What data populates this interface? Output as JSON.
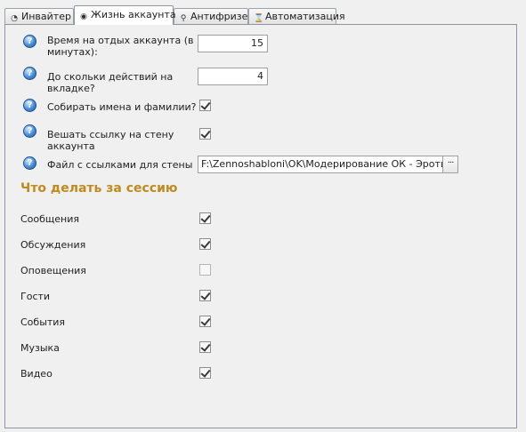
{
  "tabs": [
    {
      "label": "Инвайтер",
      "icon": "invite-icon",
      "active": false
    },
    {
      "label": "Жизнь аккаунта",
      "icon": "globe-icon",
      "active": true
    },
    {
      "label": "Антифризер",
      "icon": "search-icon",
      "active": false
    },
    {
      "label": "Автоматизация",
      "icon": "hourglass-icon",
      "active": false
    }
  ],
  "settings": {
    "rest_time_label": "Время на отдых аккаунта (в минутах):",
    "rest_time_value": "15",
    "actions_label": "До скольки действий на вкладке?",
    "actions_value": "4",
    "collect_names_label": "Собирать имена и фамилии?",
    "collect_names_checked": true,
    "wall_link_label": "Вешать ссылку на стену аккаунта",
    "wall_link_checked": true,
    "links_file_label": "Файл с ссылками для стены",
    "links_file_value": "F:\\Zennoshabloni\\OK\\Модерирование ОК - Эротика\\Ис",
    "browse_label": "···"
  },
  "session": {
    "title": "Что делать за сессию",
    "items": [
      {
        "label": "Сообщения",
        "checked": true
      },
      {
        "label": "Обсуждения",
        "checked": true
      },
      {
        "label": "Оповещения",
        "checked": false
      },
      {
        "label": "Гости",
        "checked": true
      },
      {
        "label": "События",
        "checked": true
      },
      {
        "label": "Музыка",
        "checked": true
      },
      {
        "label": "Видео",
        "checked": true
      }
    ]
  },
  "colors": {
    "section_title": "#c08a1e",
    "help_icon": "#4b8fd9"
  }
}
